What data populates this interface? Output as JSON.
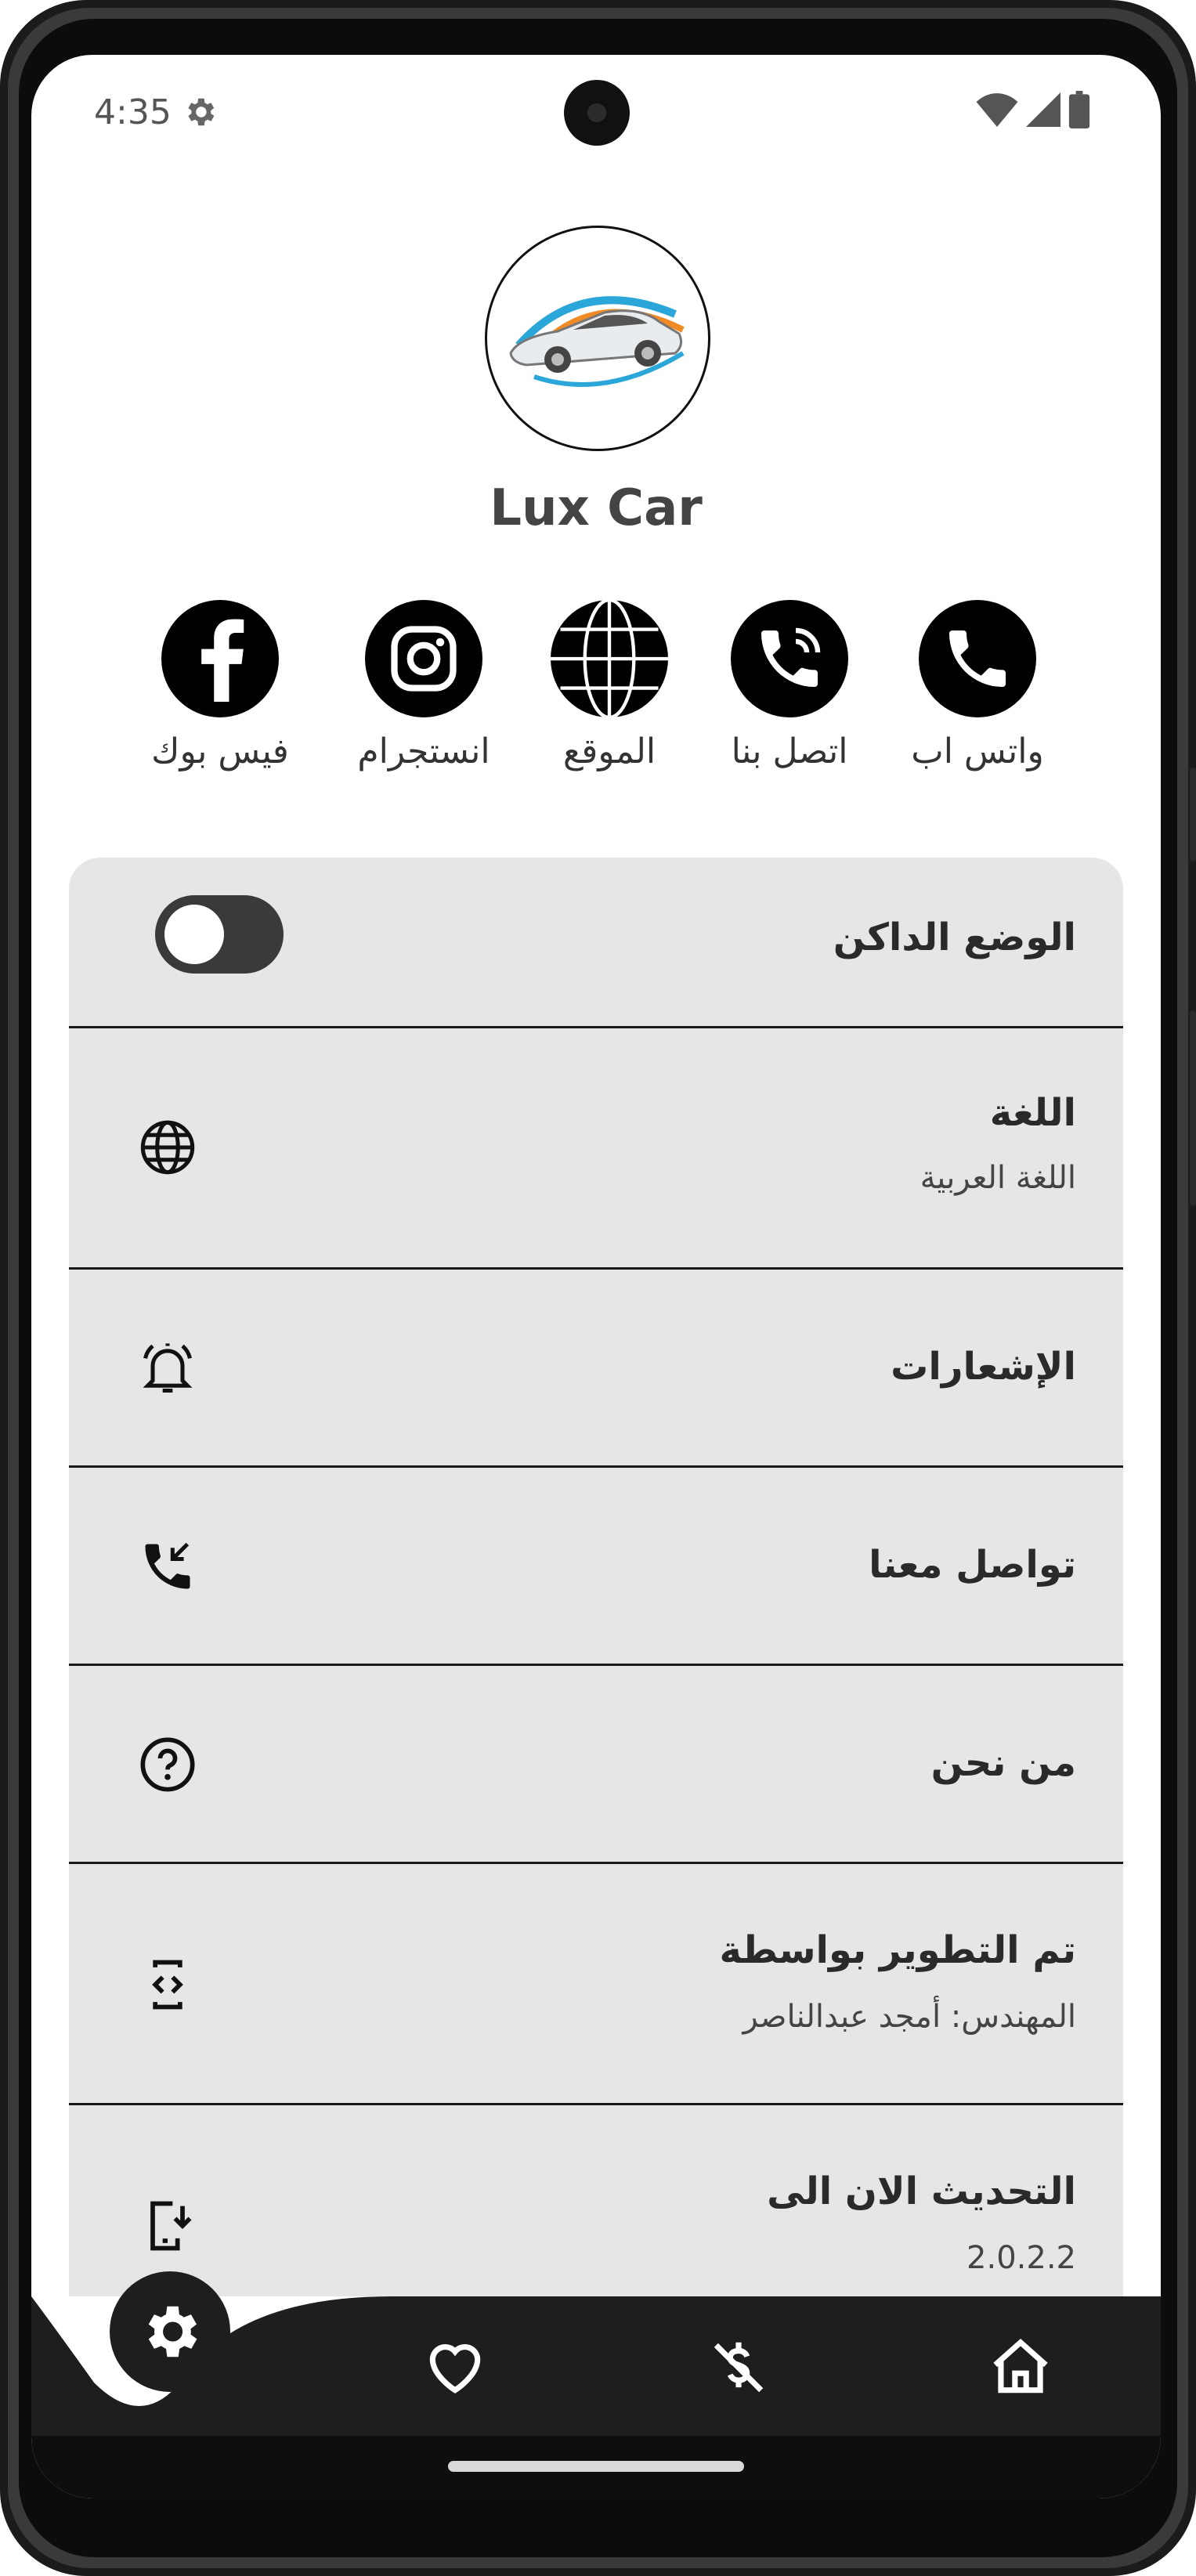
{
  "status_bar": {
    "time": "4:35"
  },
  "header": {
    "app_name": "Lux Car"
  },
  "social_links": [
    {
      "label": "واتس اب",
      "icon": "phone-icon"
    },
    {
      "label": "اتصل بنا",
      "icon": "phone-ringing-icon"
    },
    {
      "label": "الموقع",
      "icon": "globe-icon"
    },
    {
      "label": "انستجرام",
      "icon": "instagram-icon"
    },
    {
      "label": "فيس بوك",
      "icon": "facebook-icon"
    }
  ],
  "settings": {
    "dark_mode": {
      "title": "الوضع الداكن",
      "enabled": false
    },
    "language": {
      "title": "اللغة",
      "value": "اللغة العربية",
      "icon": "globe-icon"
    },
    "notifications": {
      "title": "الإشعارات",
      "icon": "bell-icon"
    },
    "contact": {
      "title": "تواصل معنا",
      "icon": "phone-callback-icon"
    },
    "about": {
      "title": "من نحن",
      "icon": "help-circle-icon"
    },
    "developer": {
      "title": "تم التطوير بواسطة",
      "value": "المهندس: أمجد عبدالناصر",
      "icon": "code-phone-icon"
    },
    "update": {
      "title": "التحديث الان الى",
      "value": "2.0.2.2",
      "icon": "phone-download-icon"
    }
  },
  "bottom_nav": {
    "items": [
      "settings-icon",
      "heart-icon",
      "money-off-icon",
      "home-icon"
    ],
    "active": "settings-icon"
  },
  "colors": {
    "nav_bg": "#1e1e1e",
    "card_bg": "#e6e6e6",
    "text": "#2a2a2a"
  }
}
